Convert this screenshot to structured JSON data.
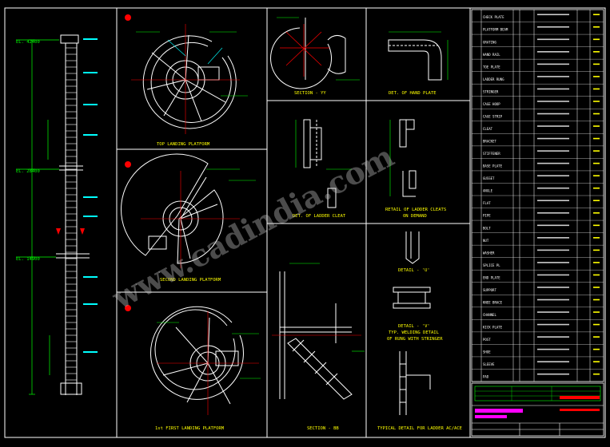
{
  "colors": {
    "background": "#000000",
    "frame": "#ffffff",
    "structure": "#ffffff",
    "dimension": "#00ff00",
    "annotation": "#00ffff",
    "accent": "#ff0000",
    "highlight": "#ff00ff",
    "title": "#ffff00",
    "watermark": "#c8c8c8"
  },
  "watermark": "www.cadindia.com",
  "elevations": {
    "top": "EL. 42400",
    "middle": "EL. 28400",
    "bottom": "EL. 14900"
  },
  "views": {
    "top_landing": "TOP LANDING PLATFORM",
    "second_landing": "SECOND LANDING PLATFORM",
    "first_landing": "1st FIRST LANDING PLATFORM",
    "section_yy": "SECTION - YY",
    "hand_plate": "DET. OF HAND PLATE",
    "ladder_cleat": "DET. OF LADDER CLEAT",
    "cleats_retail": "RETAIL OF LADDER CLEATS",
    "cleats_sub": "ON DEMAND",
    "detail_u": "DETAIL - 'U'",
    "detail_v": "DETAIL - 'V'",
    "welding_detail": "TYP. WELDING DETAIL",
    "welding_sub": "OF RUNG WITH STRINGER",
    "section_bb": "SECTION - BB",
    "ladder_ac": "TYPICAL DETAIL FOR LADDER AC/ACE"
  },
  "bom_rows": [
    "CHECK PLATE",
    "PLATFORM BEAM",
    "GRATING",
    "HAND RAIL",
    "TOE PLATE",
    "LADDER RUNG",
    "STRINGER",
    "CAGE HOOP",
    "CAGE STRIP",
    "CLEAT",
    "BRACKET",
    "STIFFENER",
    "BASE PLATE",
    "GUSSET",
    "ANGLE",
    "FLAT",
    "PIPE",
    "BOLT",
    "NUT",
    "WASHER",
    "SPLICE PL",
    "END PLATE",
    "SUPPORT",
    "KNEE BRACE",
    "CHANNEL",
    "KICK PLATE",
    "POST",
    "SHOE",
    "SLEEVE",
    "PAD"
  ]
}
